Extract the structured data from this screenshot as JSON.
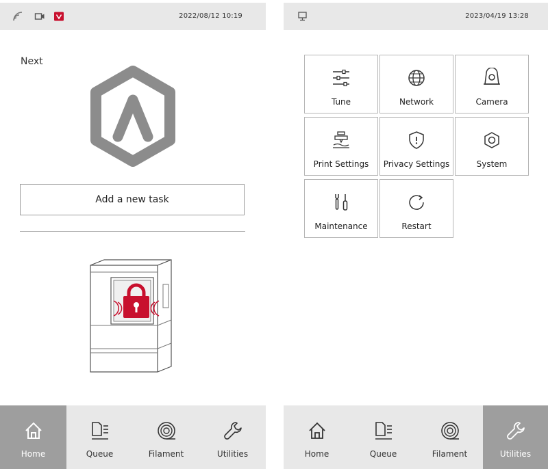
{
  "left": {
    "status": {
      "time": "2022/08/12 10:19",
      "icons": [
        "wifi-icon",
        "camera-icon",
        "shield-alert-icon"
      ]
    },
    "next_label": "Next",
    "add_task_label": "Add a new task",
    "nav": [
      {
        "label": "Home",
        "icon": "home-icon",
        "active": true
      },
      {
        "label": "Queue",
        "icon": "queue-icon",
        "active": false
      },
      {
        "label": "Filament",
        "icon": "filament-icon",
        "active": false
      },
      {
        "label": "Utilities",
        "icon": "wrench-icon",
        "active": false
      }
    ]
  },
  "right": {
    "status": {
      "time": "2023/04/19 13:28",
      "icons": [
        "network-icon"
      ]
    },
    "tiles": [
      {
        "label": "Tune",
        "icon": "sliders-icon"
      },
      {
        "label": "Network",
        "icon": "globe-icon"
      },
      {
        "label": "Camera",
        "icon": "camera-icon"
      },
      {
        "label": "Print Settings",
        "icon": "print-settings-icon"
      },
      {
        "label": "Privacy Settings",
        "icon": "privacy-shield-icon"
      },
      {
        "label": "System",
        "icon": "nut-icon"
      },
      {
        "label": "Maintenance",
        "icon": "maintenance-icon"
      },
      {
        "label": "Restart",
        "icon": "restart-icon"
      }
    ],
    "nav": [
      {
        "label": "Home",
        "icon": "home-icon",
        "active": false
      },
      {
        "label": "Queue",
        "icon": "queue-icon",
        "active": false
      },
      {
        "label": "Filament",
        "icon": "filament-icon",
        "active": false
      },
      {
        "label": "Utilities",
        "icon": "wrench-icon",
        "active": true
      }
    ]
  },
  "colors": {
    "accent_red": "#c8102e",
    "bar_gray": "#e8e8e8",
    "active_gray": "#9e9e9e",
    "logo_gray": "#8c8c8c"
  }
}
